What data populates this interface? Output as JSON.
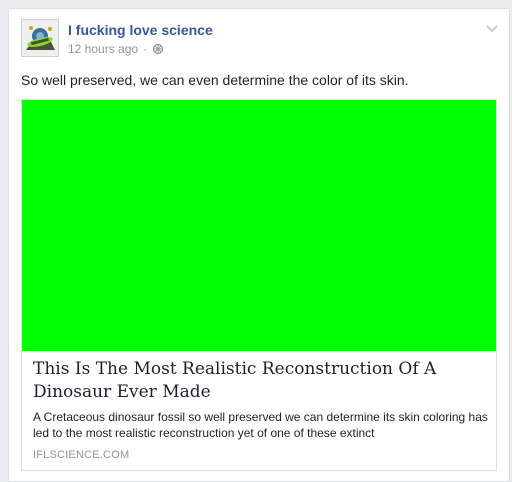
{
  "post": {
    "page_name": "I fucking love science",
    "timestamp": "12 hours ago",
    "separator": "·",
    "audience_icon": "public-globe-icon",
    "menu_icon": "chevron-down-icon",
    "text": "So well preserved, we can even determine the color of its skin."
  },
  "avatar": {
    "icon": "ifls-logo-icon"
  },
  "link": {
    "image_color": "#00ff00",
    "title": "This Is The Most Realistic Reconstruction Of A Dinosaur Ever Made",
    "description": "A Cretaceous dinosaur fossil so well preserved we can determine its skin coloring has led to the most realistic reconstruction yet of one of these extinct",
    "domain": "IFLSCIENCE.COM"
  },
  "colors": {
    "link_blue": "#365899",
    "meta_gray": "#90949c",
    "text_dark": "#1d2129",
    "border": "#dddfe2"
  }
}
